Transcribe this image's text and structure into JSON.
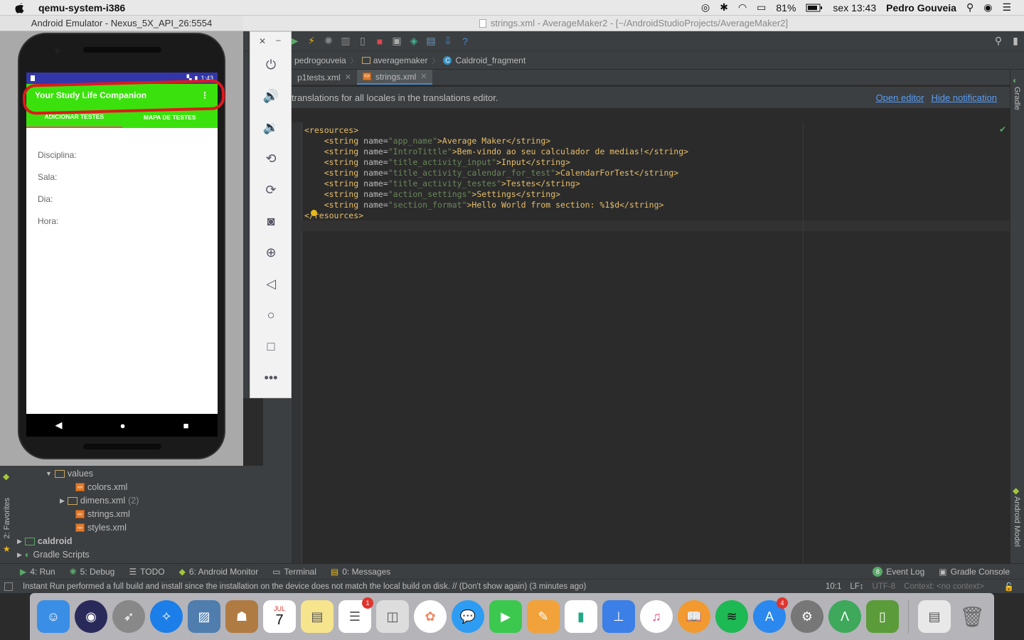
{
  "menubar": {
    "app_name": "qemu-system-i386",
    "battery": "81%",
    "clock": "sex 13:43",
    "user": "Pedro Gouveia"
  },
  "window": {
    "title": "strings.xml - AverageMaker2 - [~/AndroidStudioProjects/AverageMaker2]"
  },
  "breadcrumbs": [
    {
      "label": "pedrogouveia"
    },
    {
      "label": "averagemaker"
    },
    {
      "label": "Caldroid_fragment"
    }
  ],
  "tabs": [
    {
      "label": "p1tests.xml"
    },
    {
      "label": "strings.xml"
    }
  ],
  "notification": {
    "text": "translations for all locales in the translations editor.",
    "open_editor": "Open editor",
    "hide": "Hide notification"
  },
  "code": {
    "lines": [
      {
        "indent": "",
        "open": "<resources>",
        "name": "",
        "value": "",
        "close": ""
      },
      {
        "indent": "    ",
        "open": "<string ",
        "attr": "name=",
        "value": "\"app_name\"",
        "text": ">Average Maker</string>"
      },
      {
        "indent": "    ",
        "open": "<string ",
        "attr": "name=",
        "value": "\"IntroTittle\"",
        "text": ">Bem-vindo ao seu calculador de medias!</string>"
      },
      {
        "indent": "    ",
        "open": "<string ",
        "attr": "name=",
        "value": "\"title_activity_input\"",
        "text": ">Input</string>"
      },
      {
        "indent": "    ",
        "open": "<string ",
        "attr": "name=",
        "value": "\"title_activity_calendar_for_test\"",
        "text": ">CalendarForTest</string>"
      },
      {
        "indent": "    ",
        "open": "<string ",
        "attr": "name=",
        "value": "\"title_activity_testes\"",
        "text": ">Testes</string>"
      },
      {
        "indent": "    ",
        "open": "<string ",
        "attr": "name=",
        "value": "\"action_settings\"",
        "text": ">Settings</string>"
      },
      {
        "indent": "    ",
        "open": "<string ",
        "attr": "name=",
        "value": "\"section_format\"",
        "text": ">Hello World from section: %1$d</string>"
      },
      {
        "indent": "",
        "open": "</resources>",
        "name": "",
        "value": "",
        "close": ""
      }
    ]
  },
  "side_tools": {
    "gradle": "Gradle",
    "android_model": "Android Model",
    "favorites": "2: Favorites"
  },
  "project_tree": [
    {
      "label": "values",
      "type": "folder"
    },
    {
      "label": "colors.xml",
      "type": "xml"
    },
    {
      "label": "dimens.xml",
      "count": "(2)",
      "type": "folder"
    },
    {
      "label": "strings.xml",
      "type": "xml"
    },
    {
      "label": "styles.xml",
      "type": "xml"
    },
    {
      "label": "caldroid",
      "type": "module"
    },
    {
      "label": "Gradle Scripts",
      "type": "gradle"
    }
  ],
  "bottom_tools": [
    {
      "label": "4: Run"
    },
    {
      "label": "5: Debug"
    },
    {
      "label": "TODO"
    },
    {
      "label": "6: Android Monitor"
    },
    {
      "label": "Terminal"
    },
    {
      "label": "0: Messages"
    }
  ],
  "bottom_tools_right": [
    {
      "label": "Event Log",
      "badge": "8"
    },
    {
      "label": "Gradle Console"
    }
  ],
  "status": {
    "message": "Instant Run performed a full build and install since the installation on the device does not match the local build on disk. // (Don't show again) (3 minutes ago)",
    "position": "10:1",
    "line_sep": "LF↕",
    "encoding": "UTF-8",
    "context": "Context: <no context>"
  },
  "emulator": {
    "title": "Android Emulator - Nexus_5X_API_26:5554",
    "time": "1:43",
    "app_title": "Your Study Life Companion",
    "tab1": "ADICIONAR TESTES",
    "tab2": "MAPA DE TESTES",
    "fields": [
      "Disciplina:",
      "Sala:",
      "Dia:",
      "Hora:"
    ]
  },
  "dock": {
    "calendar_month": "JUL",
    "calendar_day": "7",
    "reminders_badge": "1",
    "appstore_badge": "4"
  },
  "colors": {
    "accent": "#3be10c",
    "status": "#3336a8",
    "link": "#589df6"
  }
}
